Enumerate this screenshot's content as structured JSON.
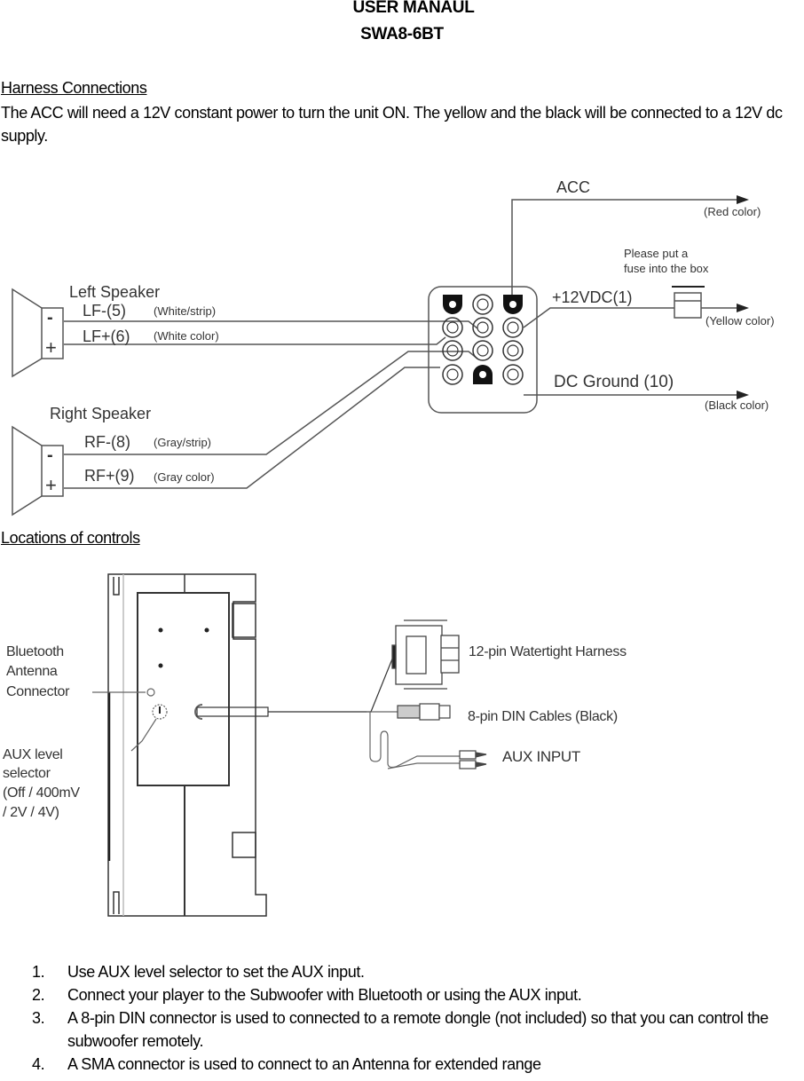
{
  "header": {
    "title": "USER MANAUL",
    "model": "SWA8-6BT"
  },
  "harness": {
    "heading": "Harness Connections",
    "intro": "The ACC will need a 12V constant power to turn the unit ON. The yellow and the black will be connected to a 12V dc supply.",
    "diagram": {
      "acc_label": "ACC",
      "acc_color": "(Red color)",
      "fuse_note_line1": "Please put a",
      "fuse_note_line2": "fuse into the box",
      "power_label": "+12VDC(1)",
      "power_color": "(Yellow color)",
      "ground_label": "DC Ground (10)",
      "ground_color": "(Black color)",
      "left_speaker": {
        "title": "Left Speaker",
        "neg_label": "LF-(5)",
        "neg_color": "(White/strip)",
        "pos_label": "LF+(6)",
        "pos_color": "(White color)"
      },
      "right_speaker": {
        "title": "Right  Speaker",
        "neg_label": "RF-(8)",
        "neg_color": "(Gray/strip)",
        "pos_label": "RF+(9)",
        "pos_color": "(Gray color)"
      },
      "minus_sign": "-",
      "plus_sign": "+"
    }
  },
  "controls": {
    "heading": "Locations of controls",
    "diagram": {
      "bt_line1": "Bluetooth",
      "bt_line2": "Antenna",
      "bt_line3": "Connector",
      "aux_line1": "AUX level",
      "aux_line2": "selector",
      "aux_line3": "(Off / 400mV",
      "aux_line4": "/ 2V / 4V)",
      "harness_label": "12-pin Watertight Harness",
      "din_label": "8-pin DIN Cables (Black)",
      "aux_input_label": "AUX INPUT"
    },
    "steps": [
      {
        "num": "1.",
        "text": "Use AUX level selector to set the AUX input."
      },
      {
        "num": "2.",
        "text": "Connect your player to the Subwoofer with Bluetooth or using the AUX input."
      },
      {
        "num": "3.",
        "text": "A 8-pin DIN connector is used to connected to a remote dongle (not included) so that you can control the subwoofer remotely."
      },
      {
        "num": "4.",
        "text": "A SMA connector is used to connect to an Antenna for extended range"
      }
    ]
  }
}
